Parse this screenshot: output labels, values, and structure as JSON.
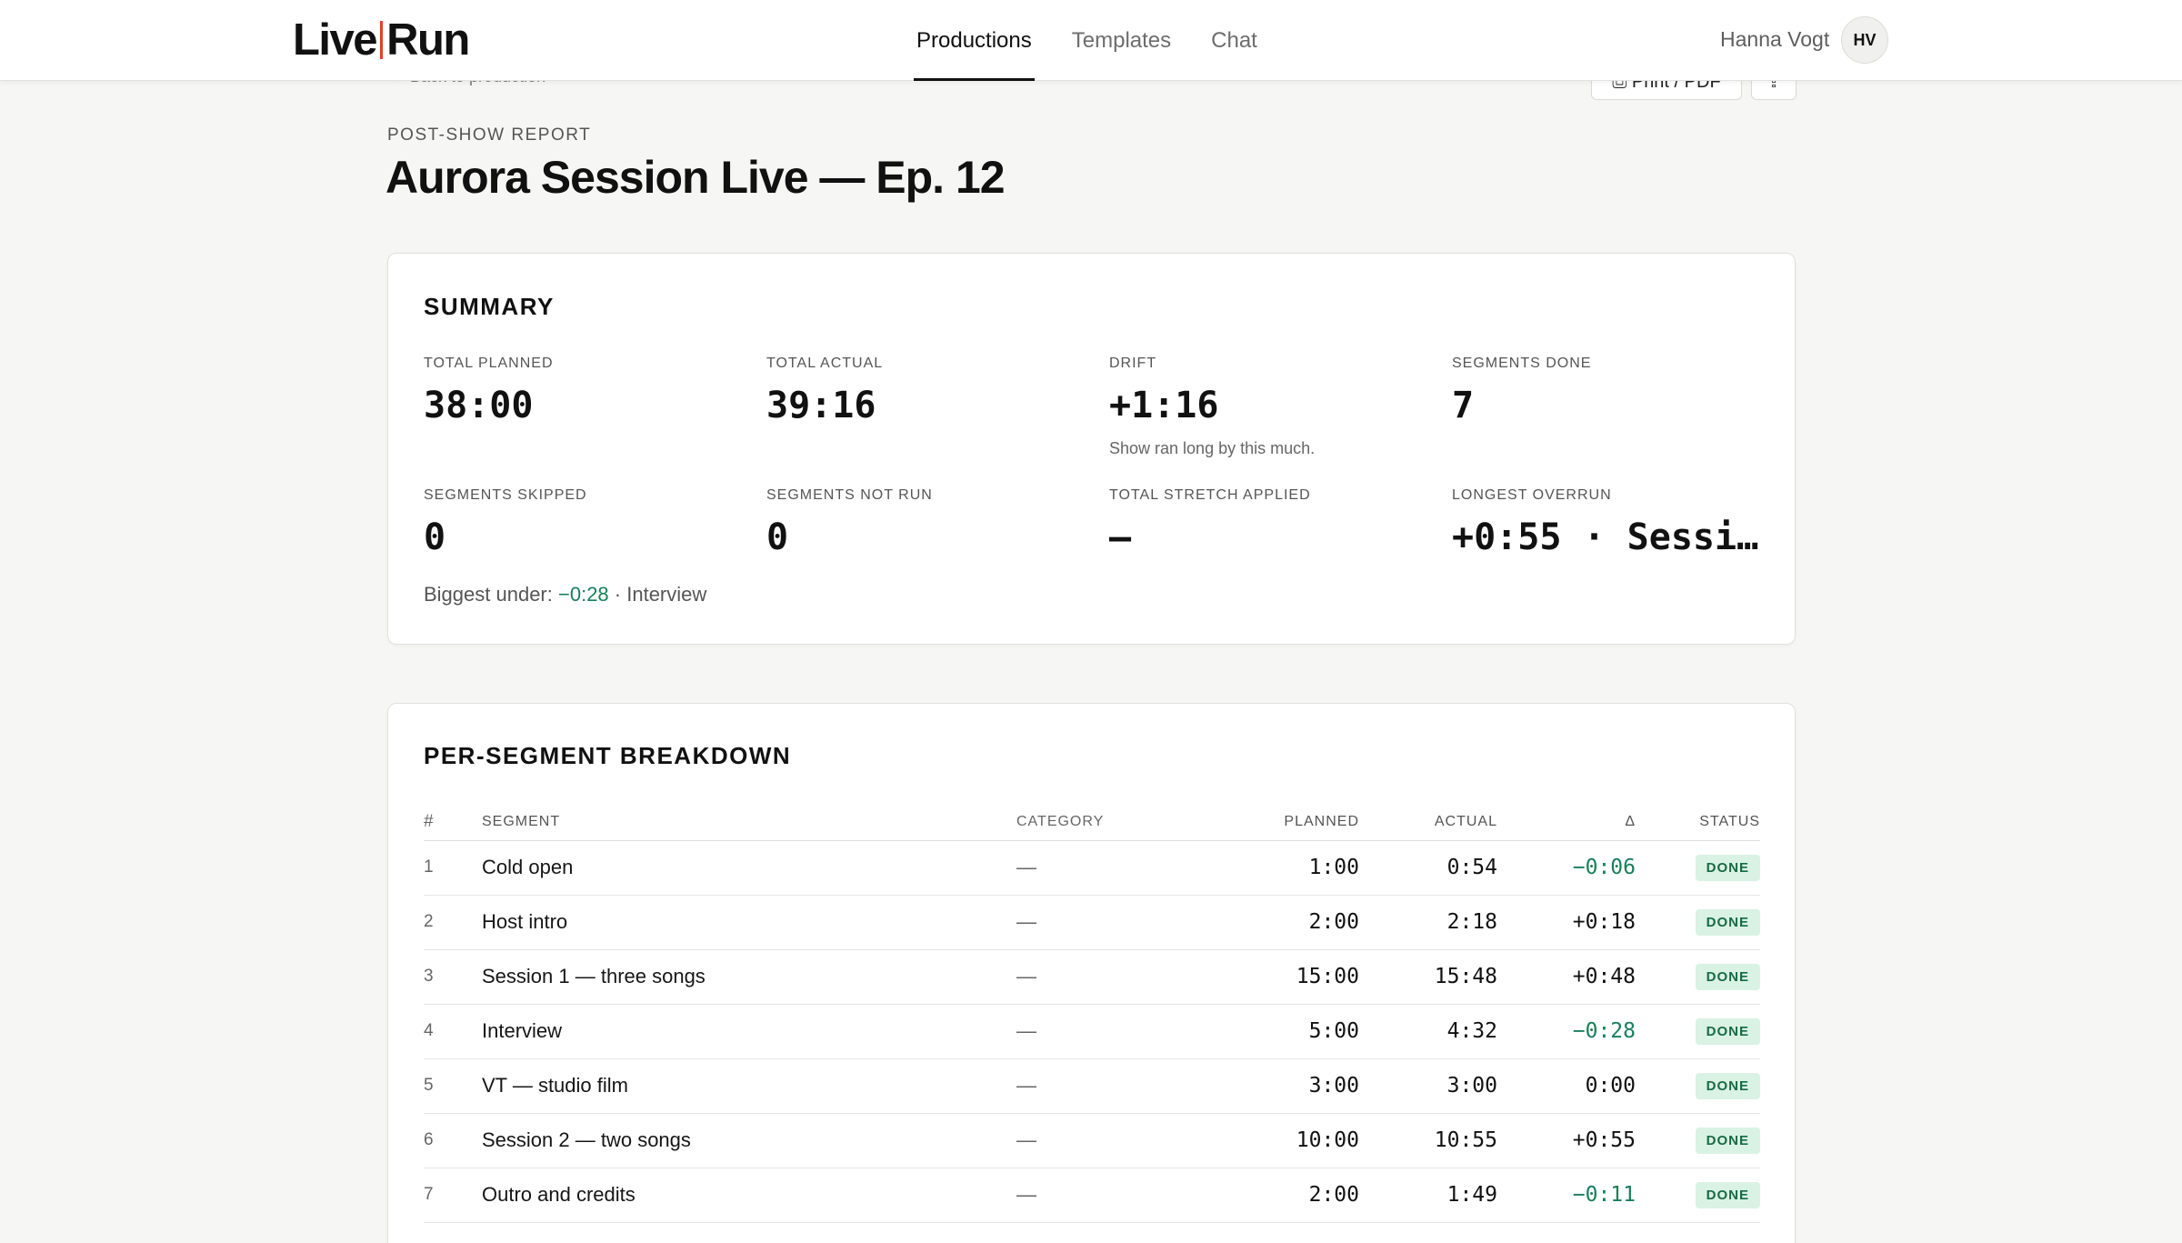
{
  "header": {
    "logo_left": "Live",
    "logo_right": "Run",
    "tabs": [
      {
        "label": "Productions",
        "active": true
      },
      {
        "label": "Templates",
        "active": false
      },
      {
        "label": "Chat",
        "active": false
      }
    ],
    "user_name": "Hanna Vogt",
    "avatar_initials": "HV"
  },
  "toolbar": {
    "back_label": "← Back to production",
    "print_label": "⎙ Print / PDF",
    "share_icon": "share-icon"
  },
  "page": {
    "eyebrow": "POST-SHOW REPORT",
    "title": "Aurora Session Live — Ep. 12"
  },
  "summary": {
    "title": "SUMMARY",
    "total_planned": {
      "label": "TOTAL PLANNED",
      "value": "38:00"
    },
    "total_actual": {
      "label": "TOTAL ACTUAL",
      "value": "39:16"
    },
    "drift": {
      "label": "DRIFT",
      "value": "+1:16",
      "note": "Show ran long by this much."
    },
    "segments_done": {
      "label": "SEGMENTS DONE",
      "value": "7"
    },
    "segments_skipped": {
      "label": "SEGMENTS SKIPPED",
      "value": "0"
    },
    "segments_not_run": {
      "label": "SEGMENTS NOT RUN",
      "value": "0"
    },
    "total_stretch": {
      "label": "TOTAL STRETCH APPLIED",
      "value": "—"
    },
    "longest_overrun": {
      "label": "LONGEST OVERRUN",
      "value": "+0:55 · Sessi…"
    },
    "biggest_under": {
      "label": "Biggest under:",
      "value": "−0:28",
      "segment": "· Interview"
    }
  },
  "breakdown": {
    "title": "PER-SEGMENT BREAKDOWN",
    "columns": {
      "num": "#",
      "segment": "SEGMENT",
      "category": "CATEGORY",
      "planned": "PLANNED",
      "actual": "ACTUAL",
      "delta": "Δ",
      "status": "STATUS"
    },
    "rows": [
      {
        "num": "1",
        "segment": "Cold open",
        "category": "—",
        "planned": "1:00",
        "actual": "0:54",
        "delta": "−0:06",
        "status": "DONE"
      },
      {
        "num": "2",
        "segment": "Host intro",
        "category": "—",
        "planned": "2:00",
        "actual": "2:18",
        "delta": "+0:18",
        "status": "DONE"
      },
      {
        "num": "3",
        "segment": "Session 1 — three songs",
        "category": "—",
        "planned": "15:00",
        "actual": "15:48",
        "delta": "+0:48",
        "status": "DONE"
      },
      {
        "num": "4",
        "segment": "Interview",
        "category": "—",
        "planned": "5:00",
        "actual": "4:32",
        "delta": "−0:28",
        "status": "DONE"
      },
      {
        "num": "5",
        "segment": "VT — studio film",
        "category": "—",
        "planned": "3:00",
        "actual": "3:00",
        "delta": "0:00",
        "status": "DONE"
      },
      {
        "num": "6",
        "segment": "Session 2 — two songs",
        "category": "—",
        "planned": "10:00",
        "actual": "10:55",
        "delta": "+0:55",
        "status": "DONE"
      },
      {
        "num": "7",
        "segment": "Outro and credits",
        "category": "—",
        "planned": "2:00",
        "actual": "1:49",
        "delta": "−0:11",
        "status": "DONE"
      }
    ]
  },
  "colors": {
    "accent": "#e0412c",
    "under": "#17805a",
    "done_badge_bg": "#d9f2e4"
  }
}
